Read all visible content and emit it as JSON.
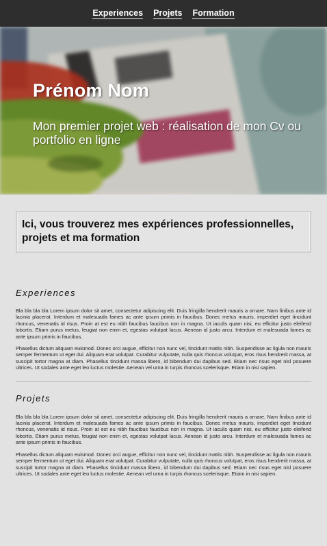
{
  "nav": {
    "items": [
      {
        "label": "Experiences"
      },
      {
        "label": "Projets"
      },
      {
        "label": "Formation"
      }
    ]
  },
  "hero": {
    "name": "Prénom Nom",
    "subtitle": "Mon premier projet web : réalisation de mon Cv ou portfolio en ligne"
  },
  "intro": {
    "text": "Ici, vous trouverez mes expériences professionnelles, projets et ma formation"
  },
  "sections": [
    {
      "title": "Experiences",
      "paragraphs": [
        "Bla bla bla bla Lorem ipsum dolor sit amet, consectetur adipiscing elit. Duis fringilla hendrerit mauris a ornare. Nam finibus ante id lacinia placerat. Interdum et malesuada fames ac ante ipsum primis in faucibus. Donec metus mauris, imperdiet eget tincidunt rhoncus, venenatis id risus. Proin at est eu nibh faucibus faucibus non in magna. Ut iaculis quam nisi, eu efficitur justo eleifend lobortis. Etiam purus metus, feugiat non enim et, egestas volutpat lacus. Aenean id justo arcu. Interdum et malesuada fames ac ante ipsum primis in faucibus.",
        "Phasellus dictum aliquam euismod. Donec orci augue, efficitur non nunc vel, tincidunt mattis nibh. Suspendisse ac ligula non mauris semper fermentum ut eget dui. Aliquam erat volutpat. Curabitur vulputate, nulla quis rhoncus volutpat, eros risus hendrerit massa, at suscipit tortor magna at diam. Phasellus tincidunt massa libero, id bibendum dui dapibus sed. Etiam nec risus eget nisl posuere ultrices. Ut sodales ante eget leo luctus molestie. Aenean vel urna in turpis rhoncus scelerisque. Etiam in nisi sapien."
      ]
    },
    {
      "title": "Projets",
      "paragraphs": [
        "Bla bla bla bla Lorem ipsum dolor sit amet, consectetur adipiscing elit. Duis fringilla hendrerit mauris a ornare. Nam finibus ante id lacinia placerat. Interdum et malesuada fames ac ante ipsum primis in faucibus. Donec metus mauris, imperdiet eget tincidunt rhoncus, venenatis id risus. Proin at est eu nibh faucibus faucibus non in magna. Ut iaculis quam nisi, eu efficitur justo eleifend lobortis. Etiam purus metus, feugiat non enim et, egestas volutpat lacus. Aenean id justo arcu. Interdum et malesuada fames ac ante ipsum primis in faucibus.",
        "Phasellus dictum aliquam euismod. Donec orci augue, efficitur non nunc vel, tincidunt mattis nibh. Suspendisse ac ligula non mauris semper fermentum ut eget dui. Aliquam erat volutpat. Curabitur vulputate, nulla quis rhoncus volutpat, eros risus hendrerit massa, at suscipit tortor magna at diam. Phasellus tincidunt massa libero, id bibendum dui dapibus sed. Etiam nec risus eget nisl posuere ultrices. Ut sodales ante eget leo luctus molestie. Aenean vel urna in turpis rhoncus scelerisque. Etiam in nisi sapien."
      ]
    }
  ]
}
